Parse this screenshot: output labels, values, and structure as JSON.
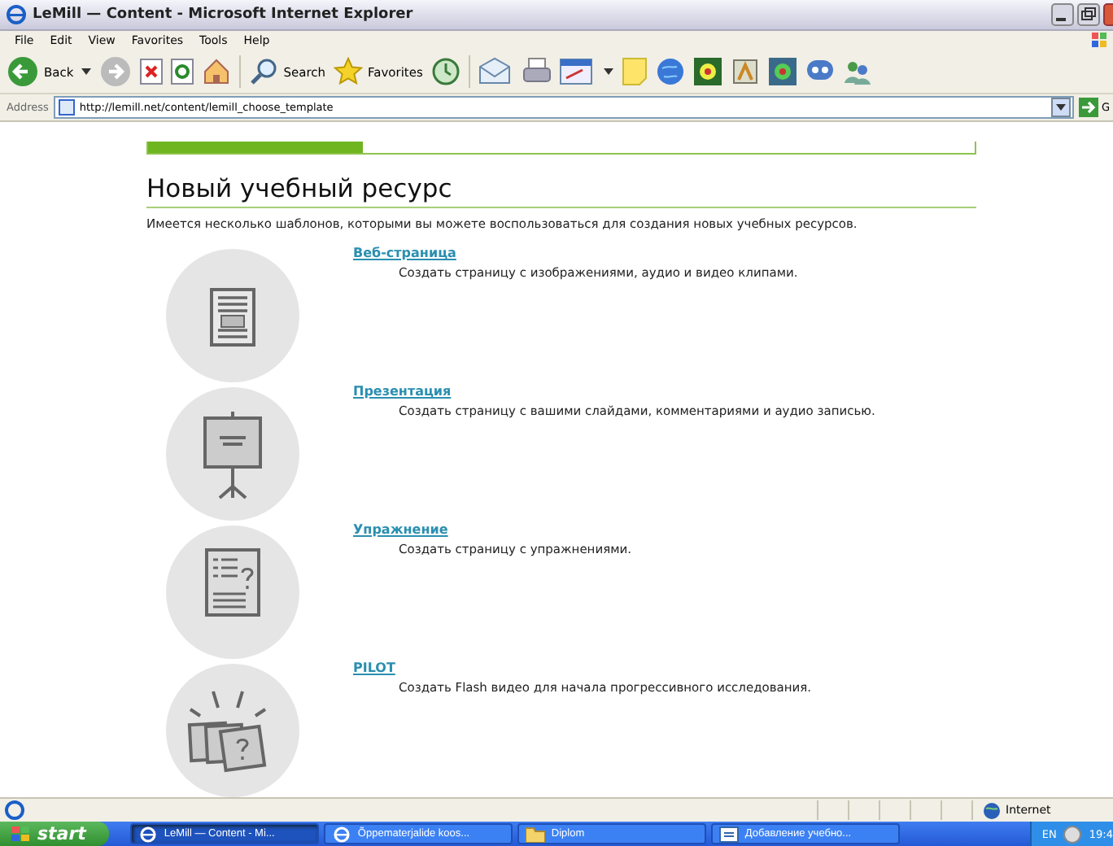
{
  "window": {
    "title": "LeMill — Content - Microsoft Internet Explorer"
  },
  "menu": [
    "File",
    "Edit",
    "View",
    "Favorites",
    "Tools",
    "Help"
  ],
  "toolbar": {
    "back": "Back",
    "search": "Search",
    "favorites": "Favorites"
  },
  "address": {
    "label": "Address",
    "url": "http://lemill.net/content/lemill_choose_template",
    "go": "G"
  },
  "page": {
    "header_bar": {
      "level": 0.26
    },
    "heading": "Новый учебный ресурс",
    "intro": "Имеется несколько шаблонов, которыми вы можете воспользоваться для создания новых учебных ресурсов.",
    "templates": [
      {
        "kind": "webpage",
        "title": "Веб-страница",
        "description": "Создать страницу с изображениями, аудио и видео клипами."
      },
      {
        "kind": "presentation",
        "title": "Презентация",
        "description": "Создать страницу с вашими слайдами, комментариями и аудио записью."
      },
      {
        "kind": "exercise",
        "title": "Упражнение",
        "description": "Создать страницу с упражнениями."
      },
      {
        "kind": "pilot",
        "title": "PILOT",
        "description": "Создать Flash видео для начала прогрессивного исследования."
      }
    ]
  },
  "status_bar": {
    "zone": "Internet"
  },
  "taskbar": {
    "start": "start",
    "tasks": [
      {
        "label": "LeMill — Content - Mi...",
        "selected": true
      },
      {
        "label": "Õppematerjalide koos...",
        "selected": false
      },
      {
        "label": "Diplom",
        "selected": false
      },
      {
        "label": "Добавление учебно...",
        "selected": false
      }
    ],
    "language": "EN",
    "clock": "19:4"
  }
}
